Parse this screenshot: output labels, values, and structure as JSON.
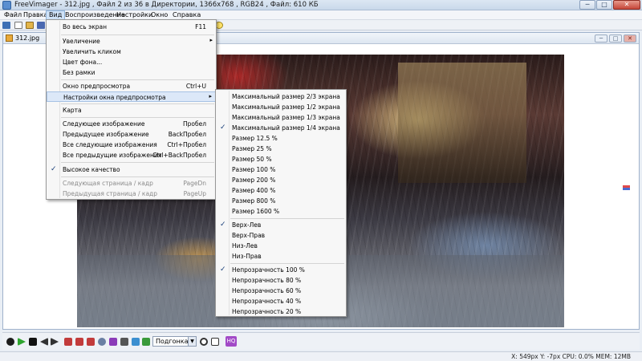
{
  "window": {
    "title": "FreeVimager - 312.jpg , Файл  2 из 36 в Директории, 1366x768 , RGB24 , Файл: 610 КБ",
    "min_label": "─",
    "max_label": "□",
    "close_label": "✕"
  },
  "menubar": {
    "items": [
      "Файл",
      "Правка",
      "Вид",
      "Воспроизведение",
      "Настройки",
      "Окно",
      "Справка"
    ]
  },
  "child": {
    "title": "312.jpg",
    "min_label": "─",
    "max_label": "□",
    "close_label": "✕"
  },
  "view_menu": {
    "items": [
      {
        "label": "Во весь экран",
        "shortcut": "F11"
      },
      {
        "label": "Увеличение",
        "submenu": "▸"
      },
      {
        "label": "Увеличить кликом"
      },
      {
        "label": "Цвет фона..."
      },
      {
        "label": "Без рамки"
      },
      {
        "label": "Окно предпросмотра",
        "shortcut": "Ctrl+U"
      },
      {
        "label": "Настройки окна предпросмотра",
        "submenu": "▸"
      },
      {
        "label": "Карта"
      },
      {
        "label": "Следующее изображение",
        "shortcut": "Пробел"
      },
      {
        "label": "Предыдущее изображение",
        "shortcut": "BackПробел"
      },
      {
        "label": "Все следующие изображения",
        "shortcut": "Ctrl+Пробел"
      },
      {
        "label": "Все предыдущие изображения",
        "shortcut": "Ctrl+BackПробел"
      },
      {
        "label": "Высокое качество",
        "check": "✓"
      },
      {
        "label": "Следующая страница / кадр",
        "shortcut": "PageDn"
      },
      {
        "label": "Предыдущая страница / кадр",
        "shortcut": "PageUp"
      }
    ]
  },
  "preview_submenu": {
    "items": [
      {
        "label": "Максимальный размер  2/3 экрана"
      },
      {
        "label": "Максимальный размер 1/2 экрана"
      },
      {
        "label": "Максимальный размер 1/3 экрана"
      },
      {
        "label": "Максимальный размер 1/4 экрана",
        "check": "✓"
      },
      {
        "label": "Размер 12.5 %"
      },
      {
        "label": "Размер  25 %"
      },
      {
        "label": "Размер 50 %"
      },
      {
        "label": "Размер 100 %"
      },
      {
        "label": "Размер 200 %"
      },
      {
        "label": "Размер 400 %"
      },
      {
        "label": "Размер 800 %"
      },
      {
        "label": "Размер 1600 %"
      },
      {
        "label": "Верх-Лев",
        "check": "✓"
      },
      {
        "label": "Верх-Прав"
      },
      {
        "label": "Низ-Лев"
      },
      {
        "label": "Низ-Прав"
      },
      {
        "label": "Непрозрачность 100 %",
        "check": "✓"
      },
      {
        "label": "Непрозрачность 80 %"
      },
      {
        "label": "Непрозрачность 60 %"
      },
      {
        "label": "Непрозрачность 40 %"
      },
      {
        "label": "Непрозрачность 20 %"
      }
    ]
  },
  "bottom_toolbar": {
    "zoom_mode": "Подгонка",
    "combo_arrow": "▼",
    "hq_badge": "HQ"
  },
  "statusbar": {
    "text": "X: 549px  Y: -7px  CPU: 0.0%  MEM: 12MB"
  },
  "colors": {
    "menu_highlight": "#dce8f8",
    "hq_badge": "#a24ac7",
    "titlebar": "#c9d8ea"
  }
}
